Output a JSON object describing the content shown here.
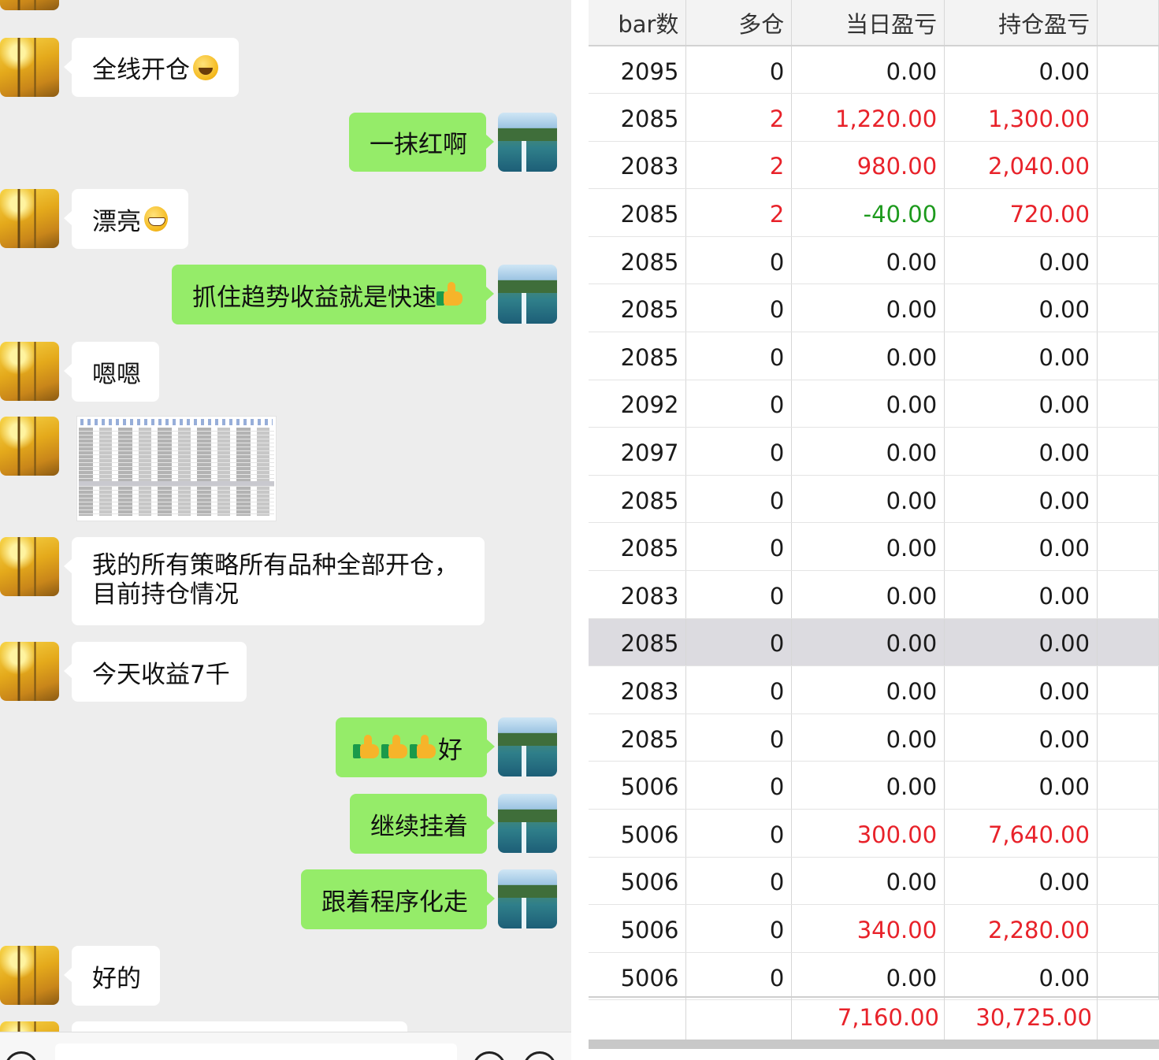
{
  "chat": {
    "messages": [
      {
        "side": "in",
        "text": "全线开仓",
        "emoji": "grinning-face"
      },
      {
        "side": "out",
        "text": "一抹红啊"
      },
      {
        "side": "in",
        "text": "漂亮",
        "emoji": "grimacing-face"
      },
      {
        "side": "out",
        "text": "抓住趋势收益就是快速",
        "emoji": "thumbs-up"
      },
      {
        "side": "in",
        "text": "嗯嗯"
      },
      {
        "side": "in",
        "type": "image",
        "content": "trading-table-screenshot-thumbnail"
      },
      {
        "side": "in",
        "text_line1": "我的所有策略所有品种全部开仓，",
        "text_line2": "目前持仓情况"
      },
      {
        "side": "in",
        "text": "今天收益7千"
      },
      {
        "side": "out",
        "text": "好",
        "emoji": "thumbs-up x3"
      },
      {
        "side": "out",
        "text": "继续挂着"
      },
      {
        "side": "out",
        "text": "跟着程序化走"
      },
      {
        "side": "in",
        "text": "好的"
      }
    ],
    "avatars": {
      "incoming": "autumn-trees-avatar",
      "outgoing": "mountain-waterfall-avatar"
    }
  },
  "table": {
    "headers": [
      "bar数",
      "多仓",
      "当日盈亏",
      "持仓盈亏"
    ],
    "rows": [
      {
        "bars": "2095",
        "long": "0",
        "daily": "0.00",
        "position": "0.00"
      },
      {
        "bars": "2085",
        "long": "2",
        "daily": "1,220.00",
        "position": "1,300.00"
      },
      {
        "bars": "2083",
        "long": "2",
        "daily": "980.00",
        "position": "2,040.00"
      },
      {
        "bars": "2085",
        "long": "2",
        "daily": "-40.00",
        "position": "720.00"
      },
      {
        "bars": "2085",
        "long": "0",
        "daily": "0.00",
        "position": "0.00"
      },
      {
        "bars": "2085",
        "long": "0",
        "daily": "0.00",
        "position": "0.00"
      },
      {
        "bars": "2085",
        "long": "0",
        "daily": "0.00",
        "position": "0.00"
      },
      {
        "bars": "2092",
        "long": "0",
        "daily": "0.00",
        "position": "0.00"
      },
      {
        "bars": "2097",
        "long": "0",
        "daily": "0.00",
        "position": "0.00"
      },
      {
        "bars": "2085",
        "long": "0",
        "daily": "0.00",
        "position": "0.00"
      },
      {
        "bars": "2085",
        "long": "0",
        "daily": "0.00",
        "position": "0.00"
      },
      {
        "bars": "2083",
        "long": "0",
        "daily": "0.00",
        "position": "0.00"
      },
      {
        "bars": "2085",
        "long": "0",
        "daily": "0.00",
        "position": "0.00",
        "selected": true
      },
      {
        "bars": "2083",
        "long": "0",
        "daily": "0.00",
        "position": "0.00"
      },
      {
        "bars": "2085",
        "long": "0",
        "daily": "0.00",
        "position": "0.00"
      },
      {
        "bars": "5006",
        "long": "0",
        "daily": "0.00",
        "position": "0.00"
      },
      {
        "bars": "5006",
        "long": "0",
        "daily": "300.00",
        "position": "7,640.00"
      },
      {
        "bars": "5006",
        "long": "0",
        "daily": "0.00",
        "position": "0.00"
      },
      {
        "bars": "5006",
        "long": "0",
        "daily": "340.00",
        "position": "2,280.00"
      },
      {
        "bars": "5006",
        "long": "0",
        "daily": "0.00",
        "position": "0.00"
      }
    ],
    "totals": {
      "daily": "7,160.00",
      "position": "30,725.00"
    },
    "colors": {
      "profit": "#e8222a",
      "loss": "#1d9a1d",
      "neutral": "#1a1a1a",
      "selected_row": "#dcdbe0"
    }
  }
}
